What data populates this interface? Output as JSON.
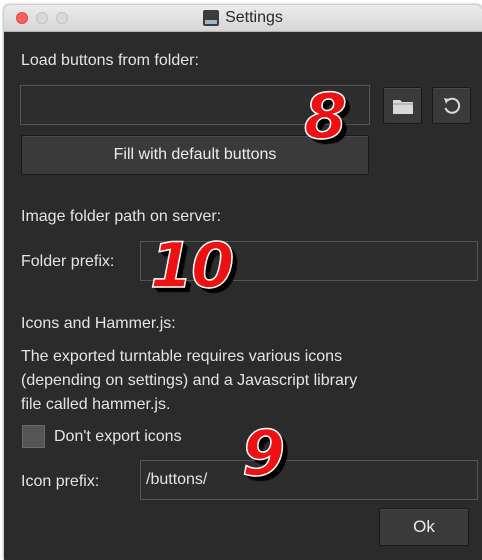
{
  "window": {
    "title": "Settings"
  },
  "load_section": {
    "label": "Load buttons from folder:",
    "path_value": "",
    "folder_icon": "folder-icon",
    "reload_icon": "reload-icon",
    "fill_button_label": "Fill with default buttons"
  },
  "server_section": {
    "label": "Image folder path on server:",
    "prefix_label": "Folder prefix:",
    "prefix_value": ""
  },
  "icons_section": {
    "heading": "Icons and Hammer.js:",
    "description_line1": "The exported turntable requires various icons",
    "description_line2": "(depending on settings) and a Javascript library",
    "description_line3": "file called hammer.js.",
    "dont_export_label": "Don't export icons",
    "dont_export_checked": false,
    "icon_prefix_label": "Icon prefix:",
    "icon_prefix_value": "/buttons/"
  },
  "ok_button_label": "Ok",
  "annotations": {
    "marker_8": "8",
    "marker_10": "10",
    "marker_9": "9"
  },
  "colors": {
    "window_bg": "#2b2b2b",
    "marker_red": "#ee1111",
    "close_button": "#fc605c"
  }
}
